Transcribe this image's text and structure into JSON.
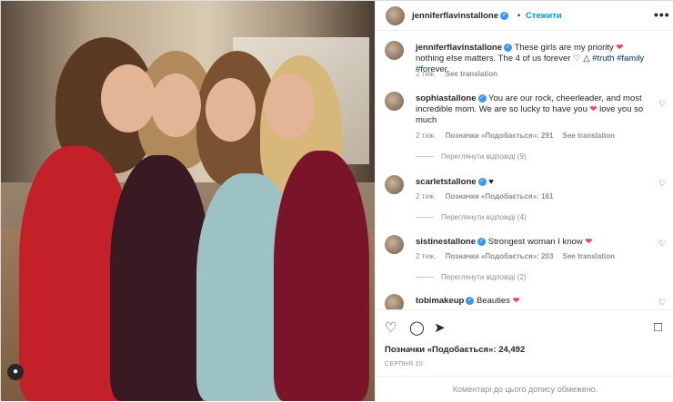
{
  "header": {
    "username": "jenniferflavinstallone",
    "dot": "•",
    "follow_label": "Стежити",
    "more_label": "•••"
  },
  "caption": {
    "username": "jenniferflavinstallone",
    "text_1": "These girls are my priority",
    "text_2": "nothing else matters. The 4 of us forever",
    "hashtags": "#truth #family #forever",
    "time": "2 тиж.",
    "see_translation": "See translation"
  },
  "comments": [
    {
      "username": "sophiastallone",
      "text_1": "You are our rock, cheerleader, and most incredible mom. We are so lucky to have you",
      "text_2": "love you so much",
      "time": "2 тиж.",
      "likes": "Позначки «Подобається»: 291",
      "see_translation": "See translation",
      "replies": "Переглянути відповіді (9)"
    },
    {
      "username": "scarletstallone",
      "text_1": "♥",
      "time": "2 тиж.",
      "likes": "Позначки «Подобається»: 161",
      "replies": "Переглянути відповіді (4)"
    },
    {
      "username": "sistinestallone",
      "text_1": "Strongest woman I know",
      "time": "2 тиж.",
      "likes": "Позначки «Подобається»: 203",
      "see_translation": "See translation",
      "replies": "Переглянути відповіді (2)"
    },
    {
      "username": "tobimakeup",
      "text_1": "Beauties"
    }
  ],
  "actions": {
    "likes_count": "Позначки «Подобається»: 24,492",
    "date": "СЕРПНЯ 10",
    "comments_disabled": "Коментарі до цього допису обмежено."
  },
  "colors": {
    "accent": "#0095f6",
    "verified": "#3897f0",
    "heart": "#ed4956",
    "muted": "#8e8e8e"
  },
  "icons": [
    "heart-icon",
    "comment-icon",
    "share-icon",
    "save-icon",
    "more-icon",
    "verified-icon",
    "user-tag-icon"
  ]
}
